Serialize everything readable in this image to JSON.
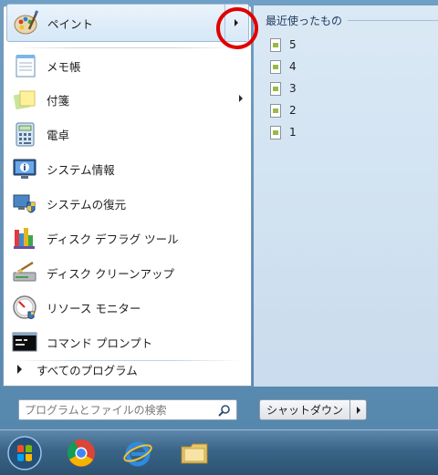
{
  "programs": {
    "items": [
      {
        "label": "ペイント",
        "icon": "paint-icon",
        "has_submenu": true
      },
      {
        "label": "メモ帳",
        "icon": "notepad-icon"
      },
      {
        "label": "付箋",
        "icon": "sticky-notes-icon",
        "has_submenu": true
      },
      {
        "label": "電卓",
        "icon": "calculator-icon"
      },
      {
        "label": "システム情報",
        "icon": "system-info-icon"
      },
      {
        "label": "システムの復元",
        "icon": "system-restore-icon"
      },
      {
        "label": "ディスク デフラグ ツール",
        "icon": "defrag-icon"
      },
      {
        "label": "ディスク クリーンアップ",
        "icon": "disk-cleanup-icon"
      },
      {
        "label": "リソース モニター",
        "icon": "resource-monitor-icon"
      },
      {
        "label": "コマンド プロンプト",
        "icon": "command-prompt-icon"
      }
    ],
    "all_programs_label": "すべてのプログラム"
  },
  "search": {
    "placeholder": "プログラムとファイルの検索"
  },
  "recent": {
    "header": "最近使ったもの",
    "items": [
      "5",
      "4",
      "3",
      "2",
      "1"
    ]
  },
  "shutdown": {
    "label": "シャットダウン"
  },
  "taskbar": {
    "items": [
      "start-orb-icon",
      "chrome-icon",
      "internet-explorer-icon",
      "file-explorer-icon"
    ]
  },
  "colors": {
    "highlight_circle": "#e00000",
    "menu_frame": "#5687ad",
    "right_pane": "#d4e4f2"
  }
}
